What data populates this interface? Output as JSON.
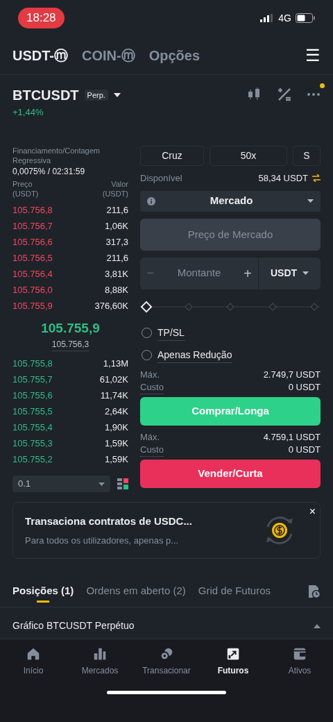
{
  "status_bar": {
    "time": "18:28",
    "network": "4G"
  },
  "market_tabs": [
    {
      "label": "USDT-ⓜ",
      "selected": true
    },
    {
      "label": "COIN-ⓜ",
      "selected": false
    },
    {
      "label": "Opções",
      "selected": false
    }
  ],
  "menu_icon": "☰",
  "symbol": {
    "name": "BTCUSDT",
    "badge": "Perp.",
    "change": "+1,44%",
    "notification": true
  },
  "funding": {
    "label": "Financiamento/Contagem Regressiva",
    "value": "0,0075% / 02:31:59"
  },
  "order_book": {
    "price_header": "Preço (USDT)",
    "value_header": "Valor (USDT)",
    "asks": [
      {
        "price": "105.756,8",
        "value": "211,6"
      },
      {
        "price": "105.756,7",
        "value": "1,06K"
      },
      {
        "price": "105.756,6",
        "value": "317,3"
      },
      {
        "price": "105.756,5",
        "value": "211,6"
      },
      {
        "price": "105.756,4",
        "value": "3,81K"
      },
      {
        "price": "105.756,0",
        "value": "8,88K"
      },
      {
        "price": "105.755,9",
        "value": "376,60K"
      }
    ],
    "last_price": "105.755,9",
    "mark_price": "105.756,3",
    "bids": [
      {
        "price": "105.755,8",
        "value": "1,13M"
      },
      {
        "price": "105.755,7",
        "value": "61,02K"
      },
      {
        "price": "105.755,6",
        "value": "11,74K"
      },
      {
        "price": "105.755,5",
        "value": "2,64K"
      },
      {
        "price": "105.755,4",
        "value": "1,90K"
      },
      {
        "price": "105.755,3",
        "value": "1,59K"
      },
      {
        "price": "105.755,2",
        "value": "1,59K"
      }
    ],
    "precision": "0.1"
  },
  "order_form": {
    "margin_mode": "Cruz",
    "leverage": "50x",
    "asset_mode": "S",
    "available_label": "Disponível",
    "available_value": "58,34 USDT",
    "order_type": "Mercado",
    "price_placeholder": "Preço de Mercado",
    "amount_placeholder": "Montante",
    "minus": "−",
    "plus": "+",
    "amount_unit": "USDT",
    "slider": {
      "level": 0
    },
    "options": [
      {
        "label": "TP/SL",
        "checked": false
      },
      {
        "label": "Apenas Redução",
        "checked": false
      }
    ],
    "sides": [
      {
        "kind": "buy",
        "max_label": "Máx.",
        "max_value": "2.749,7 USDT",
        "cost_label": "Custo",
        "cost_value": "0 USDT",
        "button": "Comprar/Longa"
      },
      {
        "kind": "sell",
        "max_label": "Máx.",
        "max_value": "4.759,1 USDT",
        "cost_label": "Custo",
        "cost_value": "0 USDT",
        "button": "Vender/Curta"
      }
    ]
  },
  "promo": {
    "title": "Transaciona contratos de USDC...",
    "subtitle": "Para todos os utilizadores, apenas p...",
    "close": "×"
  },
  "bottom_tabs": [
    {
      "label": "Posições (1)",
      "selected": true
    },
    {
      "label": "Ordens em aberto (2)",
      "selected": false
    },
    {
      "label": "Grid de Futuros",
      "selected": false
    }
  ],
  "chart_row": {
    "label": "Gráfico BTCUSDT Perpétuo"
  },
  "nav": [
    {
      "kind": "home",
      "label": "Início",
      "selected": false
    },
    {
      "kind": "markets",
      "label": "Mercados",
      "selected": false
    },
    {
      "kind": "trade",
      "label": "Transacionar",
      "selected": false
    },
    {
      "kind": "futures",
      "label": "Futuros",
      "selected": true
    },
    {
      "kind": "assets",
      "label": "Ativos",
      "selected": false
    }
  ]
}
